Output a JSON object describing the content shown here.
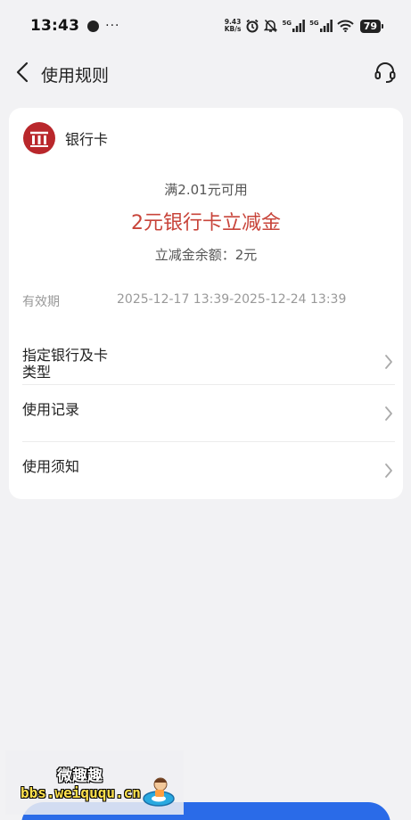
{
  "status_bar": {
    "time": "13:43",
    "more": "···",
    "net_speed_value": "9.43",
    "net_speed_unit": "KB/s",
    "sig1_label": "5G",
    "sig2_label": "5G",
    "battery": "79"
  },
  "nav": {
    "title": "使用规则"
  },
  "card": {
    "bank_name": "银行卡",
    "threshold": "满2.01元可用",
    "coupon_title": "2元银行卡立减金",
    "balance": "立减金余额：2元",
    "validity_label": "有效期",
    "validity_value": "2025-12-17 13:39-2025-12-24 13:39",
    "rows": [
      {
        "label_line1": "指定银行及卡",
        "label_line2": "类型"
      },
      {
        "label_line1": "使用记录"
      },
      {
        "label_line1": "使用须知"
      }
    ]
  },
  "watermark": {
    "title": "微趣趣",
    "url": "bbs.weiququ.cn"
  },
  "colors": {
    "accent_red": "#c8443a",
    "bank_red": "#b9272b",
    "button_blue": "#2a6be8",
    "background": "#f2f2f4"
  },
  "icons": {
    "back": "chevron-left-icon",
    "support": "headset-icon",
    "row_arrow": "chevron-right-icon",
    "bank": "bank-building-icon"
  }
}
